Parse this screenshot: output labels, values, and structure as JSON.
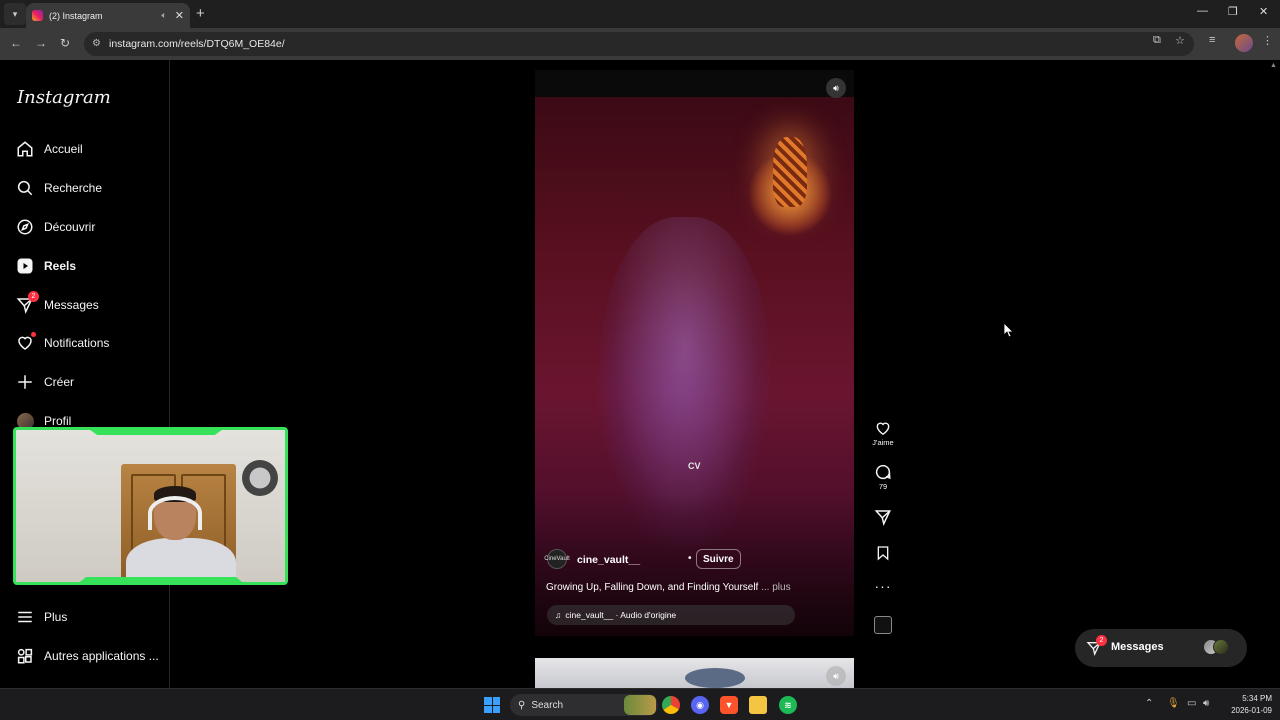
{
  "browser": {
    "tab_title": "(2) Instagram",
    "url": "instagram.com/reels/DTQ6M_OE84e/"
  },
  "sidebar": {
    "logo": "Instagram",
    "items": [
      {
        "label": "Accueil",
        "icon": "home-icon"
      },
      {
        "label": "Recherche",
        "icon": "search-icon"
      },
      {
        "label": "Découvrir",
        "icon": "compass-icon"
      },
      {
        "label": "Reels",
        "icon": "reels-icon"
      },
      {
        "label": "Messages",
        "icon": "messenger-icon",
        "badge": "2"
      },
      {
        "label": "Notifications",
        "icon": "heart-icon"
      },
      {
        "label": "Créer",
        "icon": "plus-icon"
      },
      {
        "label": "Profil",
        "icon": "avatar"
      }
    ],
    "more": "Plus",
    "other_apps": "Autres applications ..."
  },
  "reel": {
    "author": "cine_vault__",
    "follow": "Suivre",
    "caption": "Growing Up, Falling Down, and Finding Yourself",
    "caption_more": "... plus",
    "audio": "cine_vault__ · Audio d'origine",
    "watermark": "CV",
    "author_avatar_text": "CineVault",
    "actions": {
      "like_label": "J'aime",
      "comment_count": "79"
    }
  },
  "messages_dock": {
    "label": "Messages",
    "badge": "2"
  },
  "taskbar": {
    "search_label": "Search",
    "time": "5:34 PM",
    "date": "2026-01-09"
  },
  "colors": {
    "accent_red": "#ff3040",
    "webcam_border": "#35e25a",
    "bg": "#000000"
  }
}
